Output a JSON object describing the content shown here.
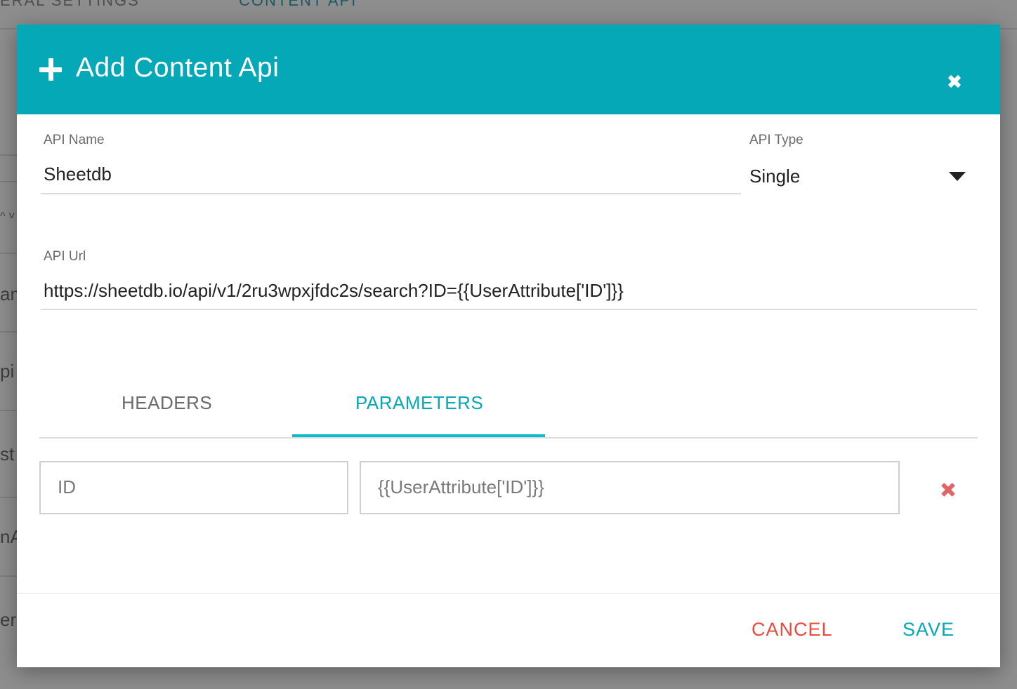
{
  "background": {
    "tab_general": "ERAL SETTINGS",
    "tab_content": "CONTENT API",
    "fragments": [
      "am",
      "pi",
      "st",
      "nA",
      "er"
    ],
    "chevrons": "^ ˅"
  },
  "modal": {
    "title": "Add Content Api",
    "api_name": {
      "label": "API Name",
      "value": "Sheetdb"
    },
    "api_type": {
      "label": "API Type",
      "value": "Single"
    },
    "api_url": {
      "label": "API Url",
      "value": "https://sheetdb.io/api/v1/2ru3wpxjfdc2s/search?ID={{UserAttribute['ID']}}"
    },
    "tabs": [
      {
        "label": "HEADERS",
        "active": false
      },
      {
        "label": "PARAMETERS",
        "active": true
      }
    ],
    "parameters": [
      {
        "key": "ID",
        "value": "{{UserAttribute['ID']}}"
      }
    ],
    "cancel_label": "CANCEL",
    "save_label": "SAVE"
  },
  "icons": {
    "add": "plus-icon",
    "close": "close-icon",
    "dropdown": "caret-down-icon",
    "remove": "remove-icon"
  },
  "colors": {
    "header": "#04a8b7",
    "accent": "#04bccb",
    "cancel": "#e94b3c",
    "remove": "#e06666"
  }
}
